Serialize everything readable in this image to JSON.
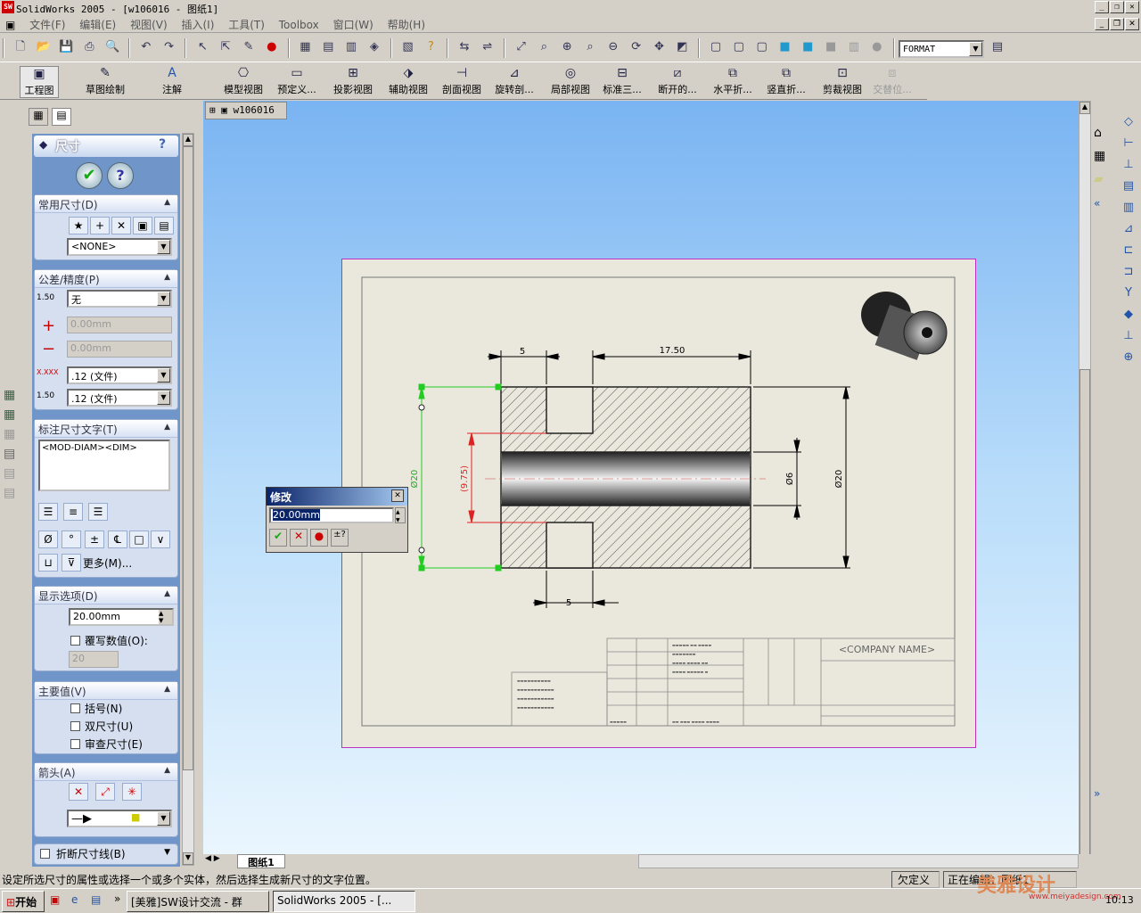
{
  "window": {
    "title": "SolidWorks 2005 - [w106016 - 图纸1]",
    "logo": "SW"
  },
  "menu": [
    "文件(F)",
    "编辑(E)",
    "视图(V)",
    "插入(I)",
    "工具(T)",
    "Toolbox",
    "窗口(W)",
    "帮助(H)"
  ],
  "toolbar": {
    "format_value": "FORMAT"
  },
  "commandmanager": [
    "工程图",
    "草图绘制",
    "注解",
    "模型视图",
    "预定义...",
    "投影视图",
    "辅助视图",
    "剖面视图",
    "旋转剖...",
    "局部视图",
    "标准三...",
    "断开的...",
    "水平折...",
    "竖直折...",
    "剪裁视图",
    "交替位..."
  ],
  "doc_tab": "w106016",
  "pm": {
    "title": "尺寸",
    "common": {
      "header": "常用尺寸(D)",
      "value": "<NONE>"
    },
    "tolerance": {
      "header": "公差/精度(P)",
      "type": "无",
      "plus": "0.00mm",
      "minus": "0.00mm",
      "precision1": ".12 (文件)",
      "precision2": ".12 (文件)",
      "icon_label1": "1.50",
      "icon_label2": "1.50"
    },
    "dimtext": {
      "header": "标注尺寸文字(T)",
      "text": "<MOD-DIAM><DIM>",
      "more": "更多(M)..."
    },
    "display": {
      "header": "显示选项(D)",
      "value": "20.00mm",
      "override_label": "覆写数值(O):",
      "override_value": "20"
    },
    "primary": {
      "header": "主要值(V)",
      "items": [
        "括号(N)",
        "双尺寸(U)",
        "审查尺寸(E)"
      ]
    },
    "arrows": {
      "header": "箭头(A)"
    },
    "break": {
      "header": "折断尺寸线(B)"
    }
  },
  "modify": {
    "title": "修改",
    "value": "20.00mm"
  },
  "drawing": {
    "dims": [
      "5",
      "17.50",
      "5",
      "(9.75)",
      "Ø20",
      "Ø6",
      "Ø20"
    ],
    "company": "<COMPANY NAME>"
  },
  "sheet_tab": "图纸1",
  "status": {
    "message": "设定所选尺寸的属性或选择一个或多个实体，然后选择生成新尺寸的文字位置。",
    "state": "欠定义",
    "editing": "正在编辑：图纸1"
  },
  "taskbar": {
    "start": "开始",
    "tasks": [
      "[美雅]SW设计交流 - 群",
      "SolidWorks 2005 - [..."
    ],
    "watermark": "美雅设计",
    "watermark_url": "www.meiyadesign.com",
    "clock": "10:13"
  }
}
